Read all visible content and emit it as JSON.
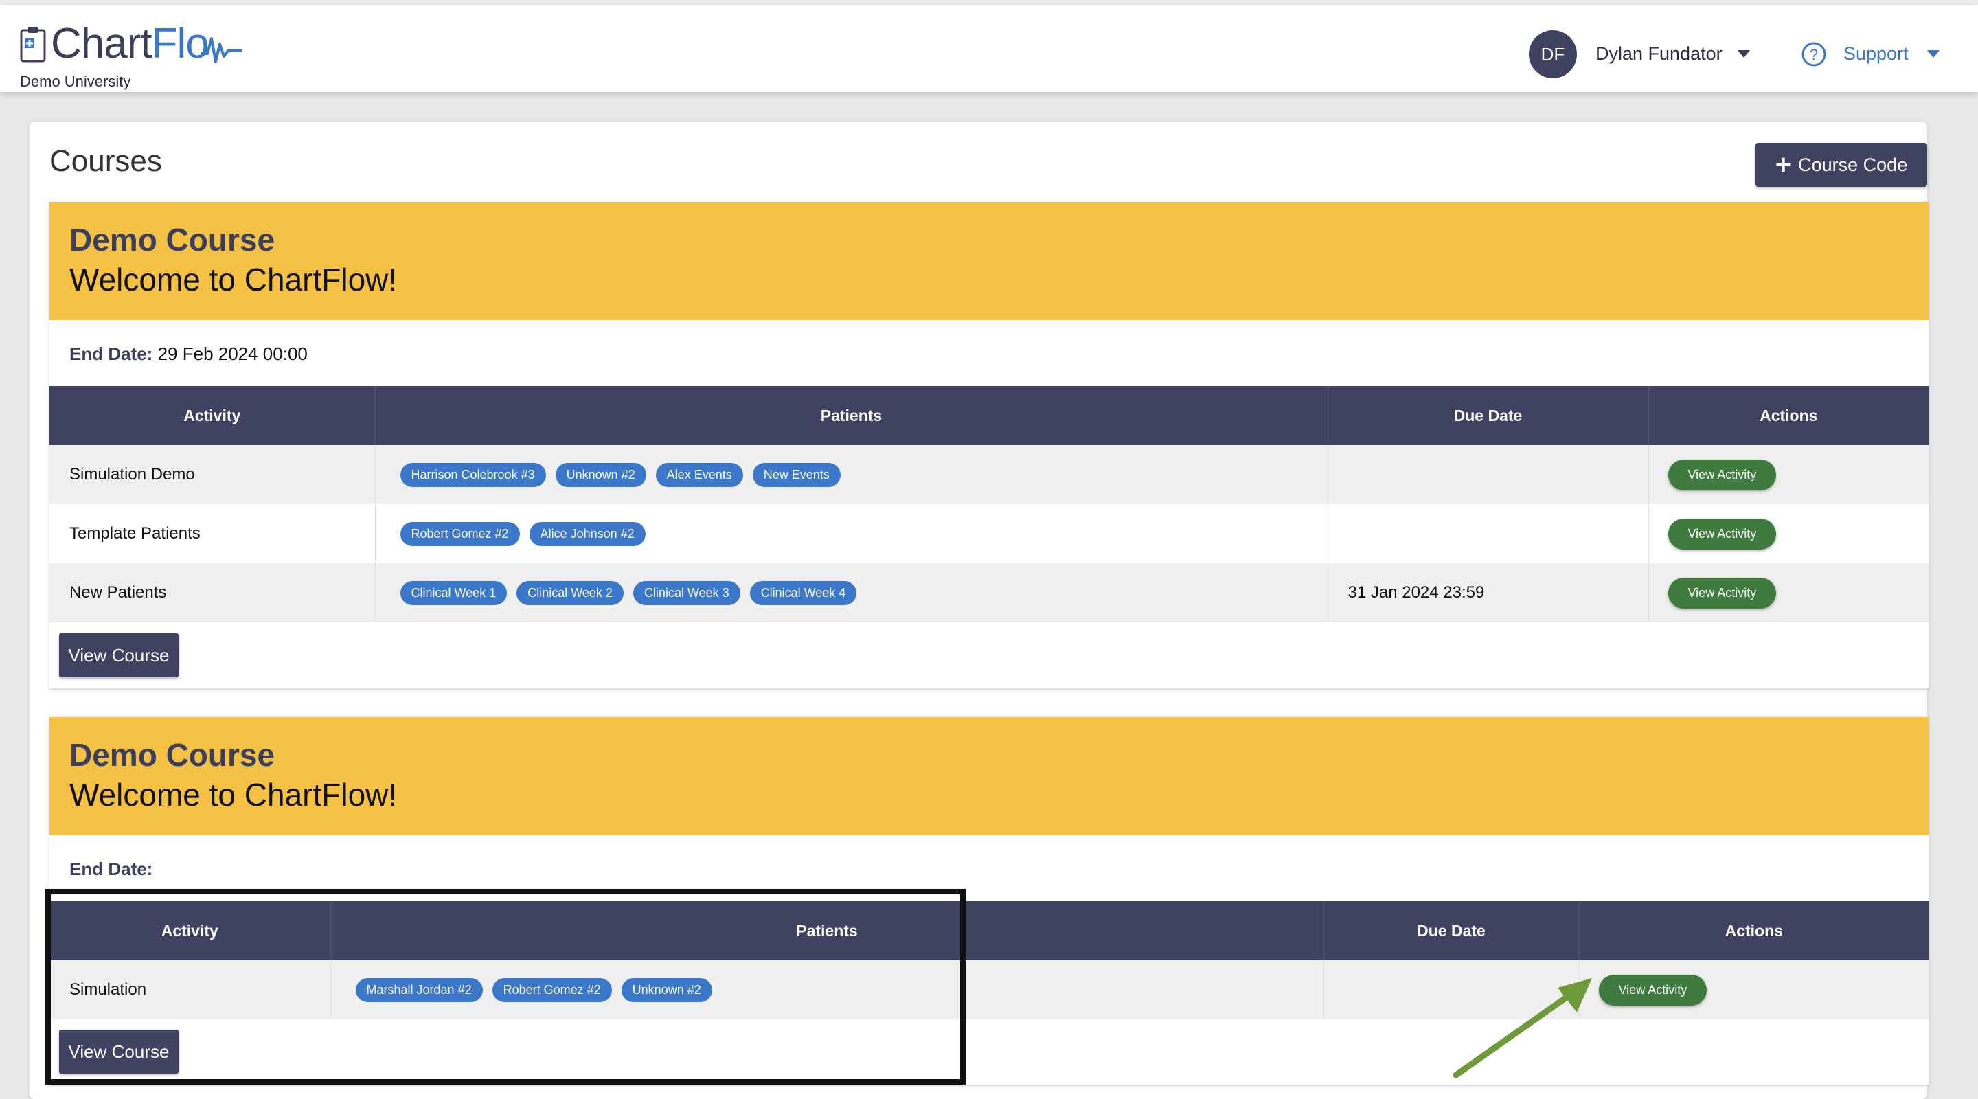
{
  "header": {
    "logo_chart": "Chart",
    "logo_flow": "Flo",
    "subtitle": "Demo University",
    "user": {
      "initials": "DF",
      "name": "Dylan Fundator"
    },
    "support_label": "Support"
  },
  "page": {
    "title": "Courses",
    "course_code_button": "Course Code"
  },
  "courses": [
    {
      "name": "Demo Course",
      "welcome": "Welcome to ChartFlow!",
      "end_date_label": "End Date:",
      "end_date_value": "29 Feb 2024 00:00",
      "columns": [
        "Activity",
        "Patients",
        "Due Date",
        "Actions"
      ],
      "rows": [
        {
          "activity": "Simulation Demo",
          "patients": [
            "Harrison Colebrook #3",
            "Unknown #2",
            "Alex Events",
            "New Events"
          ],
          "due_date": "",
          "action": "View Activity"
        },
        {
          "activity": "Template Patients",
          "patients": [
            "Robert Gomez #2",
            "Alice Johnson #2"
          ],
          "due_date": "",
          "action": "View Activity"
        },
        {
          "activity": "New Patients",
          "patients": [
            "Clinical Week 1",
            "Clinical Week 2",
            "Clinical Week 3",
            "Clinical Week 4"
          ],
          "due_date": "31 Jan 2024 23:59",
          "action": "View Activity"
        }
      ],
      "view_course_label": "View Course"
    },
    {
      "name": "Demo Course",
      "welcome": "Welcome to ChartFlow!",
      "end_date_label": "End Date:",
      "end_date_value": "",
      "columns": [
        "Activity",
        "Patients",
        "Due Date",
        "Actions"
      ],
      "rows": [
        {
          "activity": "Simulation",
          "patients": [
            "Marshall Jordan #2",
            "Robert Gomez #2",
            "Unknown #2"
          ],
          "due_date": "",
          "action": "View Activity"
        }
      ],
      "view_course_label": "View Course"
    }
  ],
  "colors": {
    "navy": "#3f4260",
    "accent_blue": "#3a78c9",
    "course_header_yellow": "#f4c144",
    "action_green": "#3f7a3e",
    "annotation_arrow": "#6f9a3a"
  },
  "icons": [
    "clipboard-icon",
    "pulse-wave-icon",
    "chevron-down-icon",
    "help-circle-icon",
    "plus-icon"
  ]
}
